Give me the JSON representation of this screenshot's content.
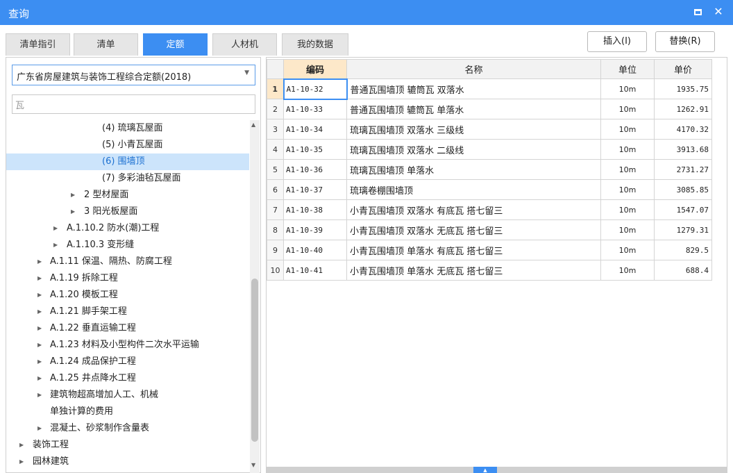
{
  "window": {
    "title": "查询",
    "close_glyph": "✕"
  },
  "tabs": [
    {
      "label": "清单指引",
      "active": false
    },
    {
      "label": "清单",
      "active": false
    },
    {
      "label": "定额",
      "active": true
    },
    {
      "label": "人材机",
      "active": false
    },
    {
      "label": "我的数据",
      "active": false
    }
  ],
  "actions": {
    "insert_label": "插入(I)",
    "replace_label": "替换(R)"
  },
  "left": {
    "library_select": "广东省房屋建筑与装饰工程综合定额(2018)",
    "search_value": "瓦",
    "tree": [
      {
        "label": "(4) 琉璃瓦屋面",
        "has_children": false,
        "selected": false
      },
      {
        "label": "(5) 小青瓦屋面",
        "has_children": false,
        "selected": false
      },
      {
        "label": "(6) 围墙顶",
        "has_children": false,
        "selected": true
      },
      {
        "label": "(7) 多彩油毡瓦屋面",
        "has_children": false,
        "selected": false
      },
      {
        "label": "2 型材屋面",
        "has_children": true,
        "selected": false
      },
      {
        "label": "3 阳光板屋面",
        "has_children": true,
        "selected": false
      },
      {
        "label": "A.1.10.2 防水(潮)工程",
        "has_children": true,
        "selected": false
      },
      {
        "label": "A.1.10.3 变形缝",
        "has_children": true,
        "selected": false
      },
      {
        "label": "A.1.11 保温、隔热、防腐工程",
        "has_children": true,
        "selected": false
      },
      {
        "label": "A.1.19 拆除工程",
        "has_children": true,
        "selected": false
      },
      {
        "label": "A.1.20 模板工程",
        "has_children": true,
        "selected": false
      },
      {
        "label": "A.1.21 脚手架工程",
        "has_children": true,
        "selected": false
      },
      {
        "label": "A.1.22 垂直运输工程",
        "has_children": true,
        "selected": false
      },
      {
        "label": "A.1.23 材料及小型构件二次水平运输",
        "has_children": true,
        "selected": false
      },
      {
        "label": "A.1.24 成品保护工程",
        "has_children": true,
        "selected": false
      },
      {
        "label": "A.1.25 井点降水工程",
        "has_children": true,
        "selected": false
      },
      {
        "label": "建筑物超高增加人工、机械",
        "has_children": true,
        "selected": false
      },
      {
        "label": "单独计算的费用",
        "has_children": false,
        "selected": false
      },
      {
        "label": "混凝土、砂浆制作含量表",
        "has_children": true,
        "selected": false
      },
      {
        "label": "装饰工程",
        "has_children": true,
        "selected": false
      },
      {
        "label": "园林建筑",
        "has_children": true,
        "selected": false
      }
    ]
  },
  "table": {
    "headers": {
      "code": "编码",
      "name": "名称",
      "unit": "单位",
      "price": "单价"
    },
    "rows": [
      {
        "idx": "1",
        "code": "A1-10-32",
        "name": "普通瓦围墙顶 辘筒瓦 双落水",
        "unit": "10m",
        "price": "1935.75"
      },
      {
        "idx": "2",
        "code": "A1-10-33",
        "name": "普通瓦围墙顶 辘筒瓦 单落水",
        "unit": "10m",
        "price": "1262.91"
      },
      {
        "idx": "3",
        "code": "A1-10-34",
        "name": "琉璃瓦围墙顶 双落水 三级线",
        "unit": "10m",
        "price": "4170.32"
      },
      {
        "idx": "4",
        "code": "A1-10-35",
        "name": "琉璃瓦围墙顶 双落水 二级线",
        "unit": "10m",
        "price": "3913.68"
      },
      {
        "idx": "5",
        "code": "A1-10-36",
        "name": "琉璃瓦围墙顶 单落水",
        "unit": "10m",
        "price": "2731.27"
      },
      {
        "idx": "6",
        "code": "A1-10-37",
        "name": "琉璃卷棚围墙顶",
        "unit": "10m",
        "price": "3085.85"
      },
      {
        "idx": "7",
        "code": "A1-10-38",
        "name": "小青瓦围墙顶 双落水 有底瓦 搭七留三",
        "unit": "10m",
        "price": "1547.07"
      },
      {
        "idx": "8",
        "code": "A1-10-39",
        "name": "小青瓦围墙顶 双落水 无底瓦 搭七留三",
        "unit": "10m",
        "price": "1279.31"
      },
      {
        "idx": "9",
        "code": "A1-10-40",
        "name": "小青瓦围墙顶 单落水 有底瓦 搭七留三",
        "unit": "10m",
        "price": "829.5"
      },
      {
        "idx": "10",
        "code": "A1-10-41",
        "name": "小青瓦围墙顶 单落水 无底瓦 搭七留三",
        "unit": "10m",
        "price": "688.4"
      }
    ]
  },
  "icons": {
    "dropdown": "▼",
    "expand": "▶",
    "scroll_up": "▲",
    "scroll_down": "▼",
    "splitter": "▲"
  },
  "colors": {
    "accent": "#3c8ef2",
    "selected_row": "#cce4fb",
    "header_highlight": "#fde8c9"
  }
}
